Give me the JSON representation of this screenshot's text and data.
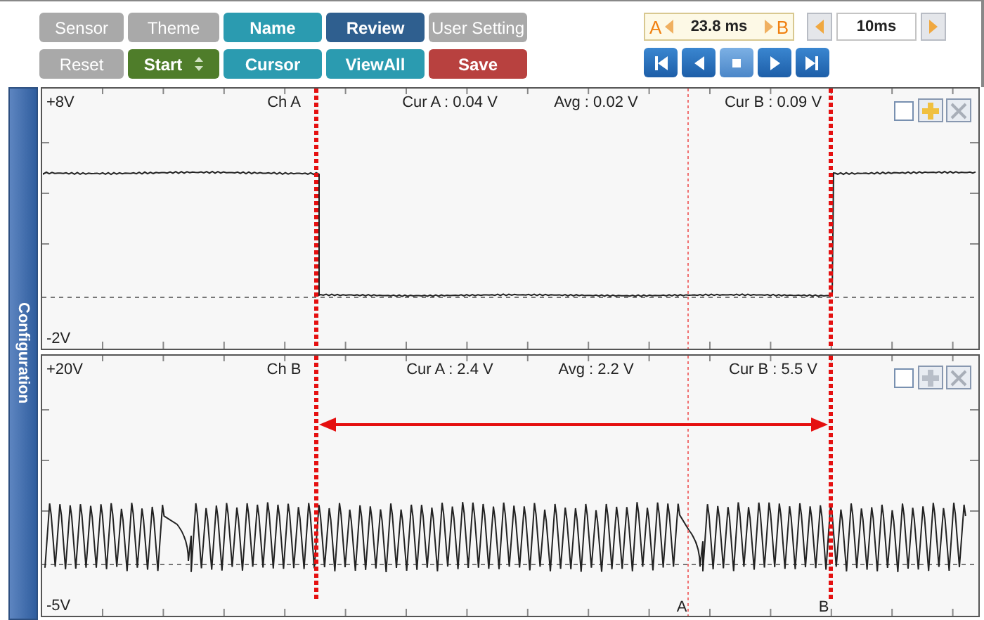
{
  "toolbar": {
    "buttons": [
      {
        "label": "Sensor",
        "color": "#a9a9a9",
        "disabled": true,
        "spinner": false
      },
      {
        "label": "Theme",
        "color": "#a9a9a9",
        "disabled": true,
        "spinner": false
      },
      {
        "label": "Name",
        "color": "#2b9bb0",
        "disabled": false,
        "spinner": false
      },
      {
        "label": "Review",
        "color": "#2f5f8f",
        "disabled": false,
        "spinner": false
      },
      {
        "label": "User Setting",
        "color": "#a9a9a9",
        "disabled": true,
        "spinner": false
      },
      {
        "label": "Reset",
        "color": "#a9a9a9",
        "disabled": true,
        "spinner": false
      },
      {
        "label": "Start",
        "color": "#4f7d2a",
        "disabled": false,
        "spinner": true
      },
      {
        "label": "Cursor",
        "color": "#2b9bb0",
        "disabled": false,
        "spinner": false
      },
      {
        "label": "ViewAll",
        "color": "#2b9bb0",
        "disabled": false,
        "spinner": false
      },
      {
        "label": "Save",
        "color": "#b8413f",
        "disabled": false,
        "spinner": false
      }
    ]
  },
  "cursor_readout": {
    "left_label": "A",
    "value": "23.8 ms",
    "right_label": "B"
  },
  "time_div": {
    "value": "10ms"
  },
  "playback": [
    {
      "kind": "first",
      "selected": false
    },
    {
      "kind": "prev",
      "selected": false
    },
    {
      "kind": "stop",
      "selected": true
    },
    {
      "kind": "next",
      "selected": false
    },
    {
      "kind": "last",
      "selected": false
    }
  ],
  "sidebar": {
    "label": "Configuration"
  },
  "panels": [
    {
      "channel": "Ch A",
      "scale_top": "+8V",
      "scale_bottom": "-2V",
      "cur_a": "Cur A : 0.04 V",
      "avg": "Avg : 0.02 V",
      "cur_b": "Cur B : 0.09 V",
      "kind": "square",
      "span_arrow": false,
      "checked": false
    },
    {
      "channel": "Ch B",
      "scale_top": "+20V",
      "scale_bottom": "-5V",
      "cur_a": "Cur A : 2.4 V",
      "avg": "Avg : 2.2 V",
      "cur_b": "Cur B : 5.5 V",
      "kind": "oscillating",
      "span_arrow": true,
      "checked": false,
      "cursor_labels": [
        "A",
        "B"
      ]
    }
  ]
}
